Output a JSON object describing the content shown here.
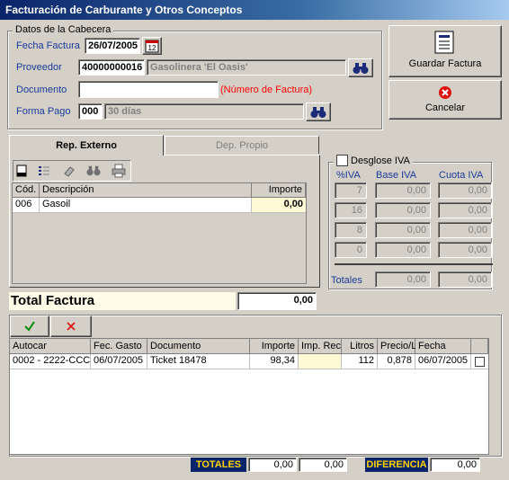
{
  "window": {
    "title": "Facturación de Carburante y Otros Conceptos"
  },
  "header_group": {
    "title": "Datos de la Cabecera",
    "fecha_label": "Fecha Factura",
    "fecha_value": "26/07/2005",
    "proveedor_label": "Proveedor",
    "proveedor_code": "40000000016",
    "proveedor_name": "Gasolinera 'El Oasis'",
    "documento_label": "Documento",
    "documento_value": "",
    "documento_hint": "(Número de Factura)",
    "formapago_label": "Forma Pago",
    "formapago_code": "000",
    "formapago_name": "30 días"
  },
  "actions": {
    "save_label": "Guardar Factura",
    "cancel_label": "Cancelar"
  },
  "tabs": [
    {
      "label": "Rep. Externo"
    },
    {
      "label": "Dep. Propio"
    }
  ],
  "concept_grid": {
    "columns": [
      "Cód.",
      "Descripción",
      "Importe"
    ],
    "rows": [
      {
        "code": "006",
        "description": "Gasoil",
        "amount": "0,00"
      }
    ]
  },
  "iva": {
    "title": "Desglose IVA",
    "headers": [
      "%IVA",
      "Base IVA",
      "Cuota IVA"
    ],
    "rows": [
      {
        "pct": "7",
        "base": "0,00",
        "cuota": "0,00"
      },
      {
        "pct": "16",
        "base": "0,00",
        "cuota": "0,00"
      },
      {
        "pct": "8",
        "base": "0,00",
        "cuota": "0,00"
      },
      {
        "pct": "0",
        "base": "0,00",
        "cuota": "0,00"
      }
    ],
    "totals_label": "Totales",
    "total_base": "0,00",
    "total_cuota": "0,00"
  },
  "total_factura": {
    "label": "Total Factura",
    "value": "0,00"
  },
  "detail_grid": {
    "columns": [
      "Autocar",
      "Fec. Gasto",
      "Documento",
      "Importe",
      "Imp. Rec",
      "Litros",
      "Precio/L",
      "Fecha"
    ],
    "rows": [
      {
        "autocar": "0002 - 2222-CCC",
        "fec_gasto": "06/07/2005",
        "documento": "Ticket 18478",
        "importe": "98,34",
        "imp_rec": "",
        "litros": "112",
        "precio": "0,878",
        "fecha": "06/07/2005"
      }
    ]
  },
  "footer": {
    "totales_label": "TOTALES",
    "total1": "0,00",
    "total2": "0,00",
    "diferencia_label": "DIFERENCIA",
    "diferencia_value": "0,00"
  },
  "colors": {
    "title_bar": "#0a246a",
    "hint_red": "#ff0000",
    "label_blue": "#1a3a9a",
    "highlight_yellow": "#fff9d6"
  }
}
